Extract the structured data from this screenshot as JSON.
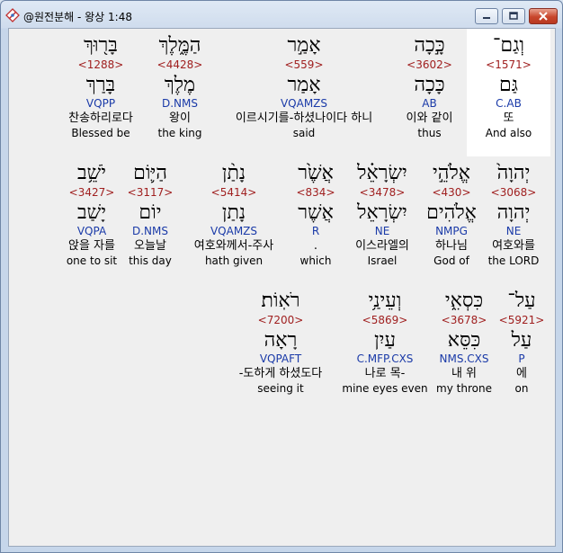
{
  "window": {
    "title": "@원전분해 - 왕상 1:48"
  },
  "rows": [
    [
      {
        "heb": "בָּר֖וּךְ",
        "strong": "<1288>",
        "lemma": "בָּרַךְ",
        "parse": "VQPP",
        "kor": "찬송하리로다",
        "eng": "Blessed be",
        "highlight": false
      },
      {
        "heb": "הַמֶּ֑לֶךְ",
        "strong": "<4428>",
        "lemma": "מֶלֶךְ",
        "parse": "D.NMS",
        "kor": "왕이",
        "eng": "the king",
        "highlight": false
      },
      {
        "heb": "אָמַ֣ר",
        "strong": "<559>",
        "lemma": "אָמַר",
        "parse": "VQAMZS",
        "kor": "이르시기를-하셨나이다 하니",
        "eng": "said",
        "highlight": false
      },
      {
        "heb": "כָּ֣כָה",
        "strong": "<3602>",
        "lemma": "כָּכָה",
        "parse": "AB",
        "kor": "이와 같이",
        "eng": "thus",
        "highlight": false
      },
      {
        "heb": "וְגַם־",
        "strong": "<1571>",
        "lemma": "גַּם",
        "parse": "C.AB",
        "kor": "또",
        "eng": "And also",
        "highlight": true
      }
    ],
    [
      {
        "heb": "יֹשֵׁ֥ב",
        "strong": "<3427>",
        "lemma": "יָשַׁב",
        "parse": "VQPA",
        "kor": "앉을 자를",
        "eng": "one to sit",
        "highlight": false
      },
      {
        "heb": "הַיּ֛וֹם",
        "strong": "<3117>",
        "lemma": "יוֹם",
        "parse": "D.NMS",
        "kor": "오늘날",
        "eng": "this day",
        "highlight": false
      },
      {
        "heb": "נָתַ֨ן",
        "strong": "<5414>",
        "lemma": "נָתַן",
        "parse": "VQAMZS",
        "kor": "여호와께서-주사",
        "eng": "hath given",
        "highlight": false
      },
      {
        "heb": "אֲשֶׁ֙ר",
        "strong": "<834>",
        "lemma": "אֲשֶׁר",
        "parse": "R",
        "kor": ".",
        "eng": "which",
        "highlight": false
      },
      {
        "heb": "יִשְׂרָאֵ֗ל",
        "strong": "<3478>",
        "lemma": "יִשְׂרָאֵל",
        "parse": "NE",
        "kor": "이스라엘의",
        "eng": "Israel",
        "highlight": false
      },
      {
        "heb": "אֱלֹהֵ֣י",
        "strong": "<430>",
        "lemma": "אֱלֹהִים",
        "parse": "NMPG",
        "kor": "하나님",
        "eng": "God of",
        "highlight": false
      },
      {
        "heb": "יְהוָה֙",
        "strong": "<3068>",
        "lemma": "יְהוָה",
        "parse": "NE",
        "kor": "여호와를",
        "eng": "the LORD",
        "highlight": false
      }
    ],
    [
      {
        "heb": "רֹאֽוֹת׃",
        "strong": "<7200>",
        "lemma": "רָאָה",
        "parse": "VQPAFT",
        "kor": "-도하게 하셨도다",
        "eng": "seeing it",
        "highlight": false
      },
      {
        "heb": "וְעֵינַ֥י",
        "strong": "<5869>",
        "lemma": "עַיִן",
        "parse": "C.MFP.CXS",
        "kor": "나로 목-",
        "eng": "mine eyes even",
        "highlight": false
      },
      {
        "heb": "כִּסְאִ֑י",
        "strong": "<3678>",
        "lemma": "כִּסֵּא",
        "parse": "NMS.CXS",
        "kor": "내 위",
        "eng": "my throne",
        "highlight": false
      },
      {
        "heb": "עַל־",
        "strong": "<5921>",
        "lemma": "עַל",
        "parse": "P",
        "kor": "에",
        "eng": "on",
        "highlight": false
      }
    ]
  ]
}
